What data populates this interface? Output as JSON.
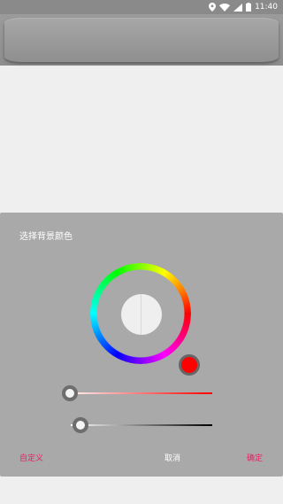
{
  "status_bar": {
    "time": "11:40",
    "icons": [
      "location-icon",
      "wifi-icon",
      "signal-icon",
      "battery-icon"
    ]
  },
  "dialog": {
    "title": "选择背景颜色",
    "selected_color": "#ff0000",
    "saturation_slider_value": 0.0,
    "brightness_slider_value": 0.07,
    "buttons": {
      "custom": "自定义",
      "cancel": "取消",
      "ok": "确定"
    }
  },
  "colors": {
    "accent": "#e91e63",
    "dialog_bg": "#a9a9a9",
    "page_bg": "#efefef"
  }
}
